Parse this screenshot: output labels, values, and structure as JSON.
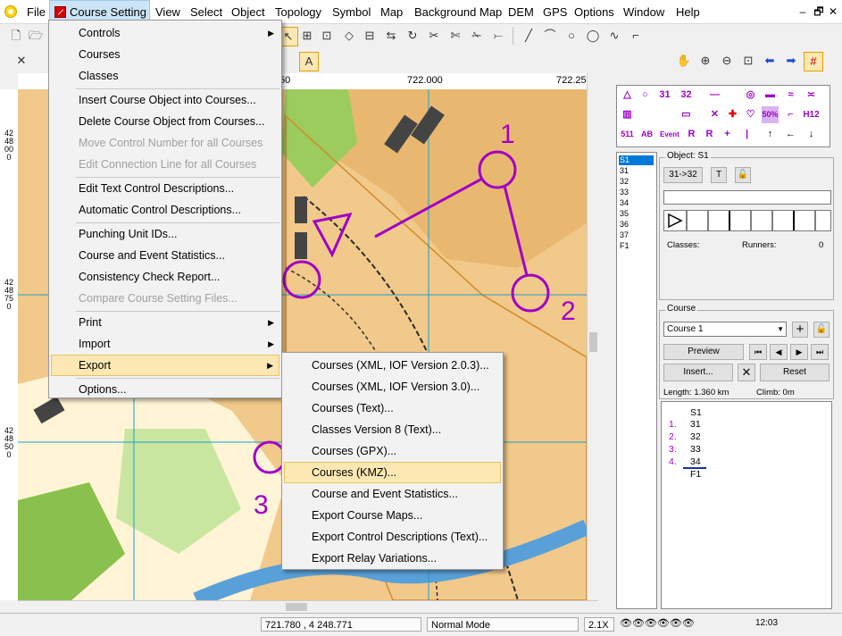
{
  "menubar": {
    "items": [
      "File",
      "Course Setting",
      "View",
      "Select",
      "Object",
      "Topology",
      "Symbol",
      "Map",
      "Background Map",
      "DEM",
      "GPS",
      "Options",
      "Window",
      "Help"
    ],
    "active": "Course Setting"
  },
  "window_controls": {
    "minimize": "–",
    "restore": "🗗",
    "close": "✕"
  },
  "ruler": {
    "top": [
      "50",
      "722.000",
      "722.250"
    ],
    "left": [
      "4248000",
      "4248750",
      "4248500"
    ]
  },
  "course_setting_menu": [
    {
      "label": "Controls",
      "submenu": true,
      "enabled": true
    },
    {
      "label": "Courses",
      "enabled": true
    },
    {
      "label": "Classes",
      "enabled": true
    },
    {
      "label": "Insert Course Object into Courses...",
      "enabled": true
    },
    {
      "label": "Delete Course Object from Courses...",
      "enabled": true
    },
    {
      "label": "Move Control Number for all Courses",
      "enabled": false
    },
    {
      "label": "Edit Connection Line for all Courses",
      "enabled": false
    },
    {
      "label": "Edit Text Control Descriptions...",
      "enabled": true
    },
    {
      "label": "Automatic Control Descriptions...",
      "enabled": true
    },
    {
      "label": "Punching Unit IDs...",
      "enabled": true
    },
    {
      "label": "Course and Event Statistics...",
      "enabled": true
    },
    {
      "label": "Consistency Check Report...",
      "enabled": true
    },
    {
      "label": "Compare Course Setting Files...",
      "enabled": false
    },
    {
      "label": "Print",
      "submenu": true,
      "enabled": true
    },
    {
      "label": "Import",
      "submenu": true,
      "enabled": true
    },
    {
      "label": "Export",
      "submenu": true,
      "enabled": true,
      "highlighted": true
    },
    {
      "label": "Options...",
      "enabled": true
    }
  ],
  "export_menu": [
    {
      "label": "Courses (XML, IOF Version 2.0.3)..."
    },
    {
      "label": "Courses (XML, IOF Version 3.0)..."
    },
    {
      "label": "Courses (Text)..."
    },
    {
      "label": "Classes Version 8 (Text)..."
    },
    {
      "label": "Courses (GPX)..."
    },
    {
      "label": "Courses (KMZ)...",
      "highlighted": true
    },
    {
      "label": "Course and Event Statistics..."
    },
    {
      "label": "Export Course Maps..."
    },
    {
      "label": "Export Control Descriptions (Text)..."
    },
    {
      "label": "Export Relay Variations..."
    }
  ],
  "symbols": {
    "row1": [
      "△",
      "○",
      "31",
      "32",
      "—",
      "◎",
      "▬",
      "≈",
      "≍"
    ],
    "row2": [
      "▥",
      "▭",
      "✕",
      "✚",
      "♡",
      "50%",
      "⌐",
      "H12"
    ],
    "row3": [
      "511",
      "AB",
      "Event",
      "R",
      "R",
      "+",
      "|",
      "↑",
      "←",
      "↓"
    ]
  },
  "codes": [
    "S1",
    "31",
    "32",
    "33",
    "34",
    "35",
    "36",
    "37",
    "F1"
  ],
  "object_panel": {
    "title": "Object: S1",
    "code_btn": "31->32",
    "text_btn": "T",
    "classes_label": "Classes:",
    "runners_label": "Runners:",
    "runners_value": "0"
  },
  "course_panel": {
    "title": "Course",
    "selected_course": "Course 1",
    "preview": "Preview",
    "insert": "Insert...",
    "reset": "Reset",
    "length": "Length: 1.360 km",
    "climb": "Climb: 0m"
  },
  "legs": [
    {
      "num": "",
      "code": "S1"
    },
    {
      "num": "1.",
      "code": "31"
    },
    {
      "num": "2.",
      "code": "32"
    },
    {
      "num": "3.",
      "code": "33"
    },
    {
      "num": "4.",
      "code": "34"
    },
    {
      "num": "",
      "code": "F1"
    }
  ],
  "statusbar": {
    "coords": "721.780 , 4 248.771",
    "mode": "Normal Mode",
    "zoom": "2.1X",
    "time": "12:03"
  },
  "colors": {
    "course": "#a000c8",
    "menu_highlight": "#fde8b4",
    "selection": "#0078d7"
  }
}
